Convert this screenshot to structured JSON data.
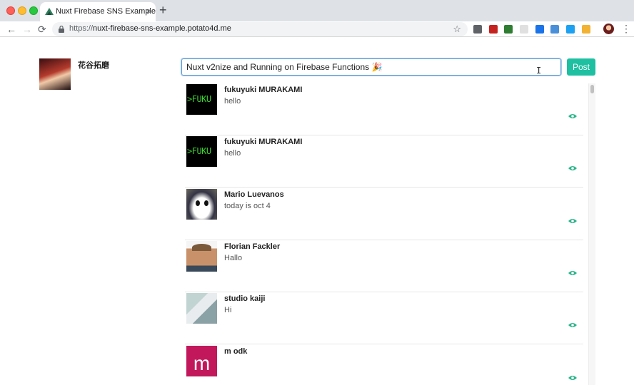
{
  "browser": {
    "tab_title": "Nuxt Firebase SNS Example",
    "new_tab_glyph": "+",
    "close_glyph": "×",
    "url_scheme": "https://",
    "url_host": "nuxt-firebase-sns-example.potato4d.me",
    "back_glyph": "←",
    "forward_glyph": "→",
    "reload_glyph": "⟳",
    "star_glyph": "☆",
    "menu_glyph": "⋮",
    "extension_colors": [
      "#5f6368",
      "#c5221f",
      "#2e7d32",
      "#e0e0e0",
      "#1a73e8",
      "#4a90d9",
      "#1da1f2",
      "#f2b233"
    ]
  },
  "user": {
    "name": "花谷拓磨"
  },
  "composer": {
    "value": "Nuxt v2nize and Running on Firebase Functions 🎉",
    "post_label": "Post"
  },
  "feed": [
    {
      "author": "fukuyuki MURAKAMI",
      "message": "hello",
      "avatar": "fuku",
      "avatar_text": ">FUKU"
    },
    {
      "author": "fukuyuki MURAKAMI",
      "message": "hello",
      "avatar": "fuku",
      "avatar_text": ">FUKU"
    },
    {
      "author": "Mario Luevanos",
      "message": "today is oct 4",
      "avatar": "panda",
      "avatar_text": ""
    },
    {
      "author": "Florian Fackler",
      "message": "Hallo",
      "avatar": "person",
      "avatar_text": ""
    },
    {
      "author": "studio kaiji",
      "message": "Hi",
      "avatar": "kaiji",
      "avatar_text": ""
    },
    {
      "author": "m odk",
      "message": "",
      "avatar": "m",
      "avatar_text": "m"
    }
  ],
  "colors": {
    "accent": "#1fbfa1",
    "eye_icon": "#2bb58a",
    "input_border": "#66a3d6"
  }
}
